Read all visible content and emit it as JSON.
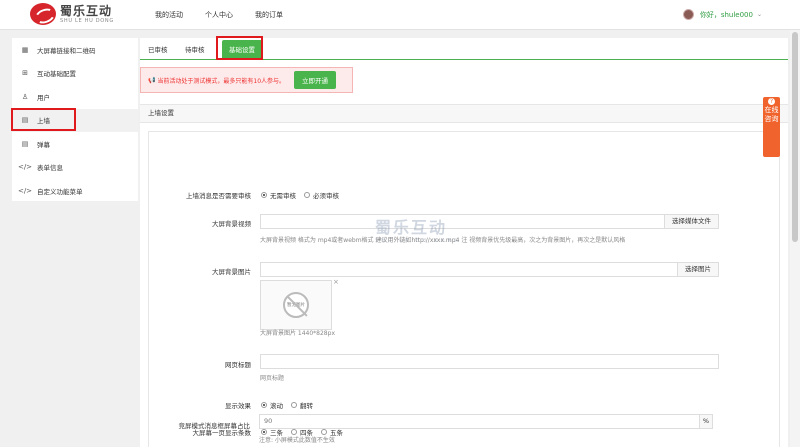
{
  "header": {
    "logo_cn": "蜀乐互动",
    "logo_en": "SHU LE HU DONG",
    "nav": [
      "我的活动",
      "个人中心",
      "我的订单"
    ],
    "greeting": "你好，shule000"
  },
  "sidebar": {
    "items": [
      {
        "label": "大屏幕链接和二维码",
        "icon": "qr-icon"
      },
      {
        "label": "互动基础配置",
        "icon": "grid-icon"
      },
      {
        "label": "用户",
        "icon": "user-icon"
      },
      {
        "label": "上墙",
        "icon": "wall-icon"
      },
      {
        "label": "弹幕",
        "icon": "barrage-icon"
      },
      {
        "label": "表单信息",
        "icon": "code-icon"
      },
      {
        "label": "自定义功能菜单",
        "icon": "code-icon"
      }
    ],
    "active_index": 3
  },
  "tabs": [
    "已审核",
    "待审核",
    "基础设置"
  ],
  "alert": {
    "text": "当前活动处于测试模式，最多只能有10人参与。",
    "button": "立即开通"
  },
  "panel": {
    "title": "上墙设置",
    "review": {
      "label": "上墙消息是否需要审核",
      "options": [
        "无需审核",
        "必须审核"
      ],
      "selected": 0
    },
    "video": {
      "label": "大屏背景视频",
      "value": "",
      "button": "选择媒体文件",
      "help": "大屏背景视频 格式为 mp4或者webm格式 建议用外链如http://xxxx.mp4 注 视频背景优先级最高，次之为背景图片，再次之是默认风格"
    },
    "image": {
      "label": "大屏背景图片",
      "value": "",
      "button": "选择图片",
      "placeholder_text": "暂无图片",
      "remove": "×",
      "help": "大屏背景图片 1440*828px"
    },
    "page_title": {
      "label": "网页标题",
      "value": "",
      "help": "网页标题"
    },
    "display": {
      "label": "显示效果",
      "options": [
        "滚动",
        "翻转"
      ],
      "selected": 0
    },
    "per_screen": {
      "label": "大屏幕一页显示条数",
      "options": [
        "三条",
        "四条",
        "五条"
      ],
      "selected": 0
    },
    "ratio": {
      "label": "竞屏模式消息框屏幕占比",
      "value": "90",
      "unit": "%",
      "help": "注意: 小屏模式此数值不生效"
    }
  },
  "watermark": {
    "cn": "蜀乐互动",
    "en": "SHU LE HU DONG"
  },
  "consult": {
    "text": "在线咨询",
    "badge": "?"
  },
  "colors": {
    "accent": "#49b44b",
    "alert": "#e33333",
    "highlight": "#e0191c",
    "consult": "#f0632d"
  }
}
